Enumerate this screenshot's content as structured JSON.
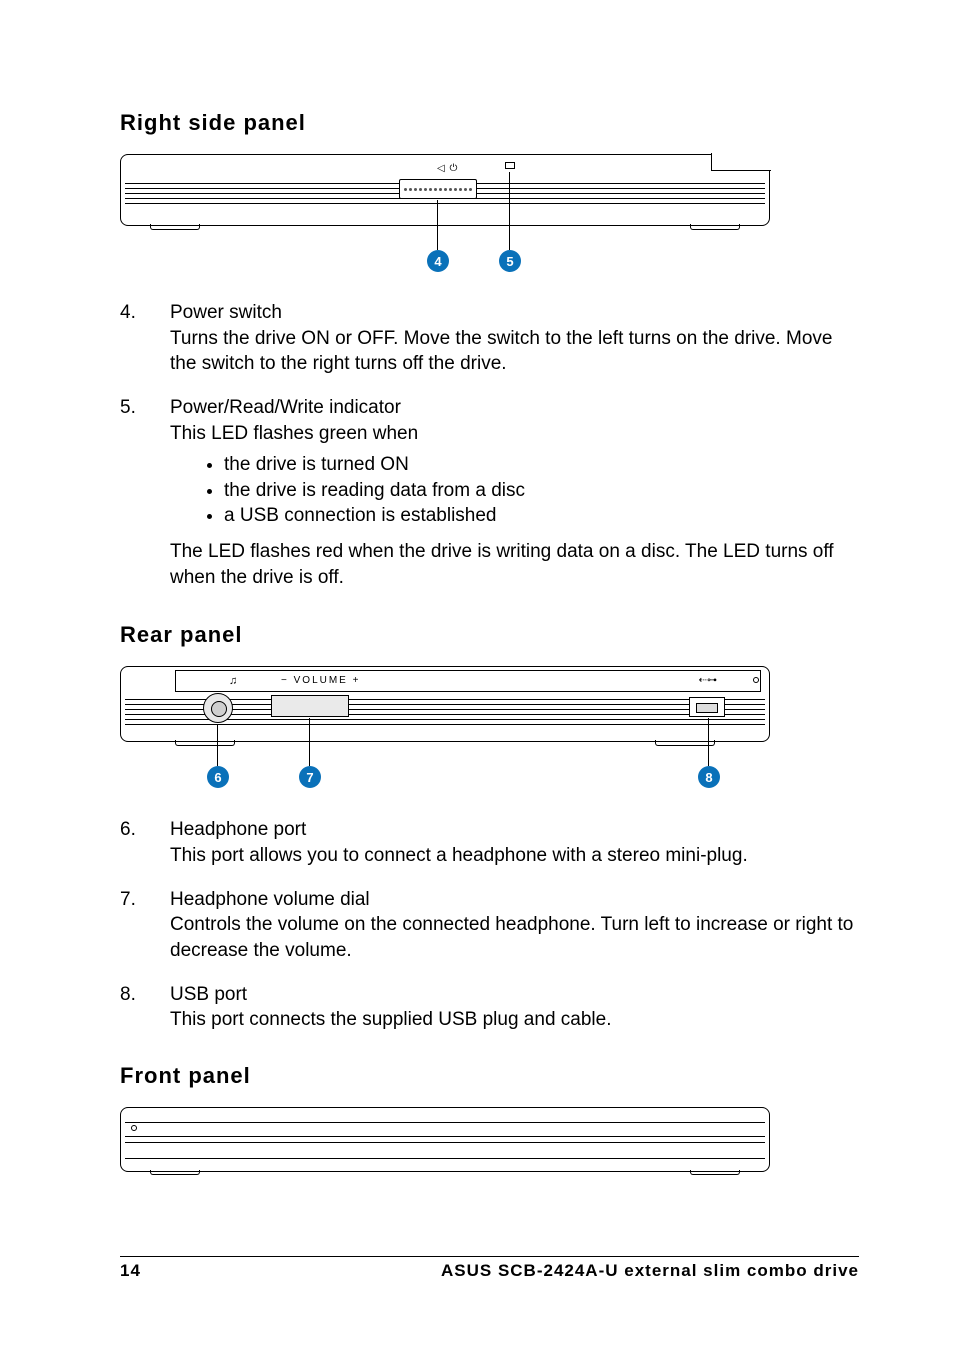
{
  "sections": {
    "right": {
      "heading": "Right side panel",
      "callouts": {
        "c4": "4",
        "c5": "5"
      },
      "items": [
        {
          "num": "4.",
          "title": "Power switch",
          "desc": "Turns the drive ON or OFF. Move the switch to the left turns on the drive. Move the switch to the right turns off the drive."
        },
        {
          "num": "5.",
          "title": "Power/Read/Write indicator",
          "desc_intro": "This LED flashes green when",
          "bullets": [
            "the drive is turned ON",
            "the drive is reading data from a disc",
            "a USB connection is established"
          ],
          "desc_after": "The LED flashes red when the drive is writing data on a disc. The LED turns off when the drive is off."
        }
      ]
    },
    "rear": {
      "heading": "Rear panel",
      "volume_label": "−   VOLUME   +",
      "callouts": {
        "c6": "6",
        "c7": "7",
        "c8": "8"
      },
      "items": [
        {
          "num": "6.",
          "title": "Headphone port",
          "desc": "This port allows you to connect a headphone with a stereo mini-plug."
        },
        {
          "num": "7.",
          "title": "Headphone volume dial",
          "desc": "Controls the volume on the connected headphone. Turn left to increase or right to decrease the volume."
        },
        {
          "num": "8.",
          "title": "USB port",
          "desc": "This port connects the supplied USB plug and cable."
        }
      ]
    },
    "front": {
      "heading": "Front panel"
    }
  },
  "footer": {
    "page_num": "14",
    "title": "ASUS SCB-2424A-U external slim combo drive"
  }
}
